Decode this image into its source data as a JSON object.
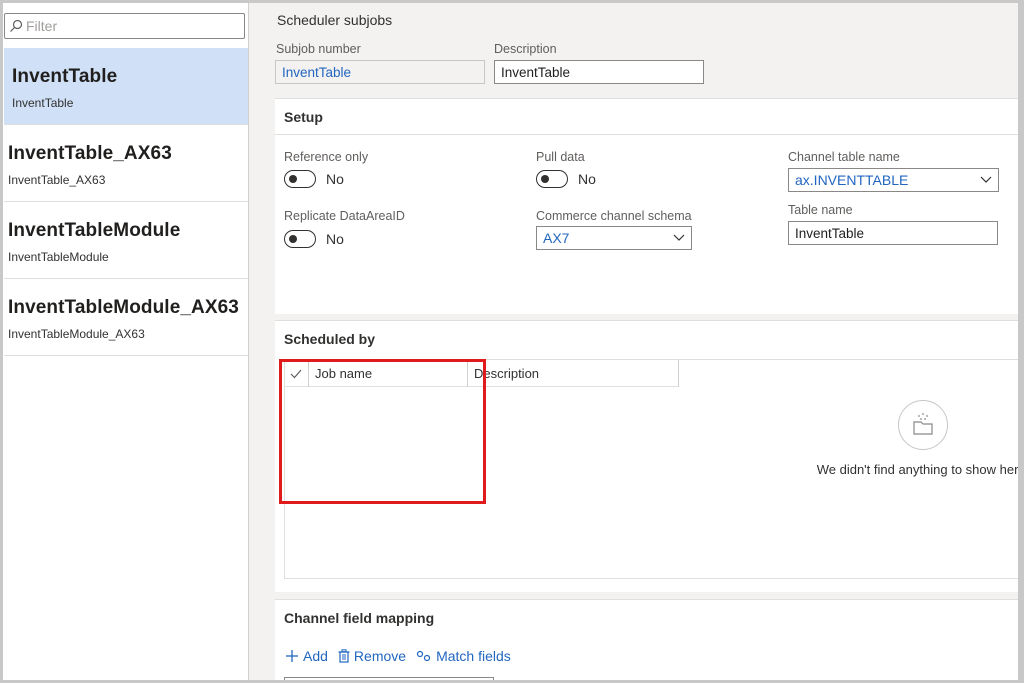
{
  "filter": {
    "placeholder": "Filter",
    "icon": "search-icon"
  },
  "list": [
    {
      "title": "InventTable",
      "subtitle": "InventTable",
      "selected": true
    },
    {
      "title": "InventTable_AX63",
      "subtitle": "InventTable_AX63",
      "selected": false
    },
    {
      "title": "InventTableModule",
      "subtitle": "InventTableModule",
      "selected": false
    },
    {
      "title": "InventTableModule_AX63",
      "subtitle": "InventTableModule_AX63",
      "selected": false
    }
  ],
  "page": {
    "title": "Scheduler subjobs",
    "subjob_number_label": "Subjob number",
    "subjob_number_value": "InventTable",
    "description_label": "Description",
    "description_value": "InventTable"
  },
  "setup": {
    "header": "Setup",
    "reference_only_label": "Reference only",
    "reference_only_value": "No",
    "pull_data_label": "Pull data",
    "pull_data_value": "No",
    "channel_table_name_label": "Channel table name",
    "channel_table_name_value": "ax.INVENTTABLE",
    "replicate_label": "Replicate DataAreaID",
    "replicate_value": "No",
    "commerce_schema_label": "Commerce channel schema",
    "commerce_schema_value": "AX7",
    "table_name_label": "Table name",
    "table_name_value": "InventTable"
  },
  "scheduled_by": {
    "header": "Scheduled by",
    "columns": [
      "Job name",
      "Description"
    ],
    "empty_message": "We didn't find anything to show here."
  },
  "channel_field_mapping": {
    "header": "Channel field mapping",
    "add_label": "Add",
    "remove_label": "Remove",
    "match_fields_label": "Match fields"
  },
  "colors": {
    "accent": "#2266c0",
    "selected": "#cfe0f7",
    "highlight": "#e01b1b"
  }
}
